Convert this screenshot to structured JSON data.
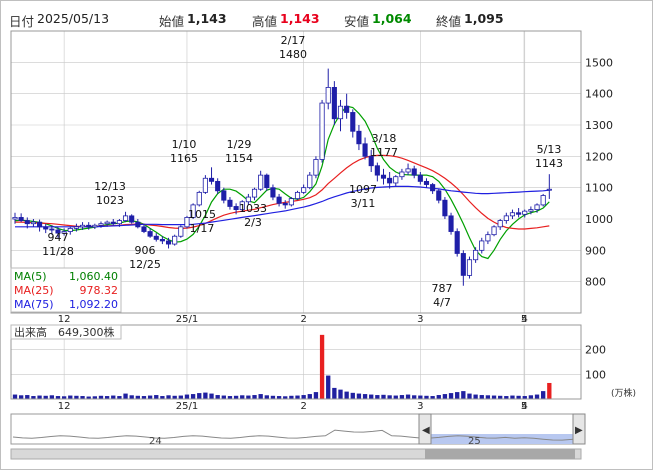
{
  "header": {
    "date_label": "日付",
    "date_value": "2025/05/13",
    "open_label": "始値",
    "open_value": "1,143",
    "high_label": "高値",
    "high_value": "1,143",
    "low_label": "安値",
    "low_value": "1,064",
    "close_label": "終値",
    "close_value": "1,095"
  },
  "colors": {
    "candle": "#1f1fa8",
    "ma5": "#00a000",
    "ma25": "#e82020",
    "ma75": "#2020e0",
    "volume": "#2020a0",
    "volume_spike": "#e82020",
    "navigator_fill": "#b8c8f0",
    "grid": "#c8c8c8"
  },
  "legend": [
    {
      "name": "MA(5)",
      "value": "1,060.40",
      "color": "#00a000"
    },
    {
      "name": "MA(25)",
      "value": "978.32",
      "color": "#e82020"
    },
    {
      "name": "MA(75)",
      "value": "1,092.20",
      "color": "#2020e0"
    }
  ],
  "volume_panel": {
    "label": "出来高",
    "value": "649,300株",
    "unit": "(万株)"
  },
  "annotations": [
    {
      "date_text": "2/17",
      "price_text": "1480"
    },
    {
      "date_text": "1/10",
      "price_text": "1165"
    },
    {
      "date_text": "1/29",
      "price_text": "1154"
    },
    {
      "date_text": "3/18",
      "price_text": "1177"
    },
    {
      "date_text": "12/13",
      "price_text": "1023"
    },
    {
      "date_text": "5/13",
      "price_text": "1143"
    },
    {
      "date_text": "11/28",
      "price_text": "947"
    },
    {
      "date_text": "12/25",
      "price_text": "906"
    },
    {
      "date_text": "1/17",
      "price_text": "1015"
    },
    {
      "date_text": "2/3",
      "price_text": "1033"
    },
    {
      "date_text": "3/11",
      "price_text": "1097"
    },
    {
      "date_text": "4/7",
      "price_text": "787"
    }
  ],
  "navigator": {
    "label_left": "24",
    "label_right": "25"
  },
  "chart_data": {
    "type": "candlestick",
    "period": "2024-11-19 to 2025-05-13",
    "x_tick_labels": [
      "12",
      "25/1",
      "2",
      "3",
      "4",
      "5"
    ],
    "y_ticks": [
      800,
      900,
      1000,
      1100,
      1200,
      1300,
      1400,
      1500
    ],
    "ylim": [
      700,
      1600
    ],
    "volume_ticks": [
      100,
      200
    ],
    "volume_ylim": [
      0,
      300
    ],
    "candles": [
      [
        1000,
        1020,
        985,
        1005
      ],
      [
        1005,
        1018,
        990,
        995
      ],
      [
        995,
        1005,
        970,
        985
      ],
      [
        985,
        1000,
        975,
        990
      ],
      [
        990,
        998,
        960,
        975
      ],
      [
        975,
        985,
        955,
        968
      ],
      [
        968,
        980,
        950,
        965
      ],
      [
        965,
        975,
        940,
        955
      ],
      [
        955,
        970,
        947,
        960
      ],
      [
        960,
        975,
        950,
        970
      ],
      [
        970,
        985,
        960,
        975
      ],
      [
        975,
        990,
        965,
        980
      ],
      [
        980,
        990,
        966,
        975
      ],
      [
        975,
        985,
        968,
        980
      ],
      [
        980,
        992,
        972,
        985
      ],
      [
        985,
        995,
        975,
        990
      ],
      [
        990,
        1000,
        980,
        985
      ],
      [
        985,
        1000,
        975,
        995
      ],
      [
        995,
        1023,
        990,
        1010
      ],
      [
        1010,
        1015,
        985,
        990
      ],
      [
        990,
        1000,
        970,
        975
      ],
      [
        975,
        985,
        955,
        960
      ],
      [
        960,
        970,
        940,
        945
      ],
      [
        945,
        955,
        928,
        935
      ],
      [
        935,
        945,
        920,
        930
      ],
      [
        930,
        940,
        906,
        920
      ],
      [
        920,
        950,
        915,
        945
      ],
      [
        945,
        980,
        940,
        975
      ],
      [
        975,
        1010,
        970,
        1005
      ],
      [
        1005,
        1050,
        1000,
        1045
      ],
      [
        1045,
        1090,
        1040,
        1085
      ],
      [
        1085,
        1140,
        1080,
        1130
      ],
      [
        1130,
        1165,
        1110,
        1120
      ],
      [
        1120,
        1130,
        1080,
        1090
      ],
      [
        1090,
        1100,
        1050,
        1060
      ],
      [
        1060,
        1070,
        1030,
        1040
      ],
      [
        1040,
        1050,
        1015,
        1030
      ],
      [
        1030,
        1060,
        1025,
        1055
      ],
      [
        1055,
        1080,
        1045,
        1070
      ],
      [
        1070,
        1100,
        1060,
        1095
      ],
      [
        1095,
        1154,
        1090,
        1140
      ],
      [
        1140,
        1145,
        1090,
        1100
      ],
      [
        1100,
        1110,
        1060,
        1070
      ],
      [
        1070,
        1080,
        1040,
        1050
      ],
      [
        1050,
        1060,
        1033,
        1045
      ],
      [
        1045,
        1070,
        1040,
        1065
      ],
      [
        1065,
        1090,
        1060,
        1085
      ],
      [
        1085,
        1110,
        1080,
        1100
      ],
      [
        1100,
        1150,
        1095,
        1140
      ],
      [
        1140,
        1200,
        1130,
        1190
      ],
      [
        1190,
        1380,
        1180,
        1370
      ],
      [
        1370,
        1480,
        1350,
        1420
      ],
      [
        1420,
        1440,
        1300,
        1320
      ],
      [
        1320,
        1380,
        1280,
        1360
      ],
      [
        1360,
        1400,
        1320,
        1340
      ],
      [
        1340,
        1350,
        1260,
        1280
      ],
      [
        1280,
        1300,
        1220,
        1240
      ],
      [
        1240,
        1260,
        1190,
        1200
      ],
      [
        1200,
        1220,
        1150,
        1170
      ],
      [
        1170,
        1180,
        1120,
        1140
      ],
      [
        1140,
        1160,
        1110,
        1130
      ],
      [
        1130,
        1150,
        1097,
        1115
      ],
      [
        1115,
        1140,
        1105,
        1135
      ],
      [
        1135,
        1160,
        1125,
        1150
      ],
      [
        1150,
        1177,
        1140,
        1160
      ],
      [
        1160,
        1170,
        1130,
        1140
      ],
      [
        1140,
        1150,
        1110,
        1120
      ],
      [
        1120,
        1130,
        1100,
        1110
      ],
      [
        1110,
        1115,
        1080,
        1090
      ],
      [
        1090,
        1095,
        1050,
        1060
      ],
      [
        1060,
        1070,
        1000,
        1010
      ],
      [
        1010,
        1020,
        950,
        960
      ],
      [
        960,
        970,
        880,
        890
      ],
      [
        890,
        900,
        787,
        820
      ],
      [
        820,
        880,
        810,
        870
      ],
      [
        870,
        910,
        860,
        900
      ],
      [
        900,
        940,
        890,
        930
      ],
      [
        930,
        960,
        920,
        950
      ],
      [
        950,
        980,
        945,
        975
      ],
      [
        975,
        1000,
        965,
        995
      ],
      [
        995,
        1020,
        985,
        1010
      ],
      [
        1010,
        1030,
        1000,
        1020
      ],
      [
        1020,
        1035,
        1005,
        1015
      ],
      [
        1015,
        1030,
        1005,
        1025
      ],
      [
        1025,
        1040,
        1015,
        1030
      ],
      [
        1030,
        1050,
        1020,
        1045
      ],
      [
        1045,
        1080,
        1040,
        1075
      ],
      [
        1095,
        1143,
        1064,
        1095
      ]
    ],
    "volume_values": [
      18,
      15,
      16,
      12,
      14,
      13,
      15,
      12,
      11,
      14,
      13,
      12,
      10,
      11,
      13,
      12,
      14,
      12,
      22,
      15,
      13,
      12,
      14,
      16,
      12,
      15,
      13,
      14,
      18,
      20,
      24,
      26,
      22,
      16,
      14,
      12,
      13,
      15,
      14,
      16,
      20,
      15,
      13,
      12,
      11,
      13,
      14,
      16,
      20,
      28,
      260,
      95,
      45,
      38,
      30,
      25,
      22,
      20,
      18,
      16,
      17,
      15,
      14,
      16,
      18,
      15,
      14,
      13,
      12,
      16,
      20,
      24,
      28,
      32,
      22,
      18,
      16,
      15,
      14,
      13,
      12,
      14,
      13,
      12,
      15,
      18,
      32,
      65
    ],
    "series": [
      {
        "name": "MA(5)",
        "values": [
          995,
          996,
          995,
          992,
          989,
          985,
          978,
          970,
          964,
          963,
          965,
          968,
          971,
          974,
          978,
          982,
          985,
          987,
          992,
          994,
          991,
          983,
          970,
          958,
          944,
          934,
          926,
          928,
          936,
          951,
          977,
          1012,
          1054,
          1081,
          1095,
          1095,
          1089,
          1075,
          1058,
          1052,
          1072,
          1092,
          1098,
          1095,
          1080,
          1066,
          1063,
          1069,
          1087,
          1112,
          1169,
          1254,
          1303,
          1336,
          1360,
          1356,
          1337,
          1312,
          1273,
          1225,
          1190,
          1165,
          1150,
          1142,
          1141,
          1140,
          1140,
          1140,
          1135,
          1120,
          1095,
          1062,
          1025,
          985,
          940,
          900,
          880,
          874,
          900,
          935,
          962,
          983,
          1000,
          1013,
          1020,
          1025,
          1035,
          1055
        ]
      },
      {
        "name": "MA(25)",
        "values": [
          990,
          990,
          989,
          988,
          987,
          986,
          985,
          983,
          981,
          979,
          977,
          976,
          976,
          976,
          977,
          978,
          979,
          980,
          982,
          983,
          984,
          983,
          981,
          979,
          976,
          973,
          971,
          970,
          971,
          974,
          979,
          986,
          995,
          1004,
          1012,
          1018,
          1022,
          1025,
          1028,
          1031,
          1036,
          1041,
          1046,
          1050,
          1053,
          1056,
          1059,
          1063,
          1068,
          1077,
          1093,
          1113,
          1130,
          1147,
          1163,
          1177,
          1188,
          1196,
          1201,
          1203,
          1203,
          1202,
          1199,
          1194,
          1187,
          1179,
          1171,
          1163,
          1154,
          1143,
          1130,
          1115,
          1098,
          1078,
          1056,
          1036,
          1018,
          1002,
          990,
          980,
          973,
          970,
          968,
          968,
          970,
          972,
          975,
          978
        ]
      },
      {
        "name": "MA(75)",
        "values": [
          975,
          975,
          975,
          975,
          975,
          975,
          975,
          975,
          975,
          975,
          975,
          975,
          975,
          975,
          976,
          977,
          978,
          979,
          980,
          981,
          982,
          983,
          983,
          983,
          982,
          982,
          982,
          982,
          982,
          983,
          985,
          987,
          990,
          993,
          996,
          999,
          1002,
          1005,
          1008,
          1011,
          1014,
          1017,
          1020,
          1023,
          1026,
          1030,
          1034,
          1038,
          1043,
          1049,
          1056,
          1064,
          1071,
          1077,
          1083,
          1088,
          1092,
          1096,
          1099,
          1101,
          1102,
          1103,
          1104,
          1104,
          1104,
          1103,
          1102,
          1100,
          1098,
          1096,
          1093,
          1090,
          1088,
          1086,
          1084,
          1082,
          1081,
          1081,
          1082,
          1083,
          1084,
          1085,
          1086,
          1087,
          1088,
          1089,
          1090,
          1092
        ]
      }
    ]
  }
}
